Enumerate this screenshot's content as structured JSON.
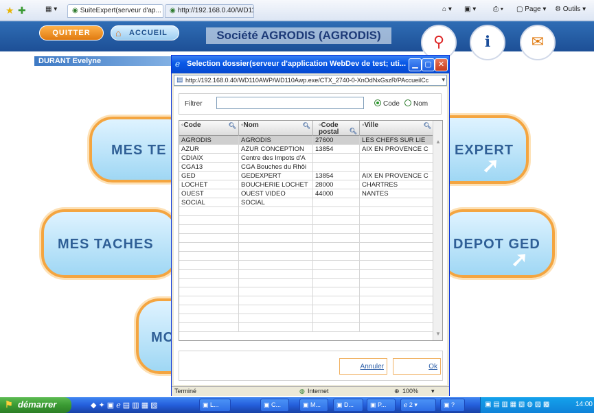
{
  "browser": {
    "tabs": [
      {
        "label": "SuiteExpert(serveur d'ap...",
        "close": "×"
      },
      {
        "label": "http://192.168.0.40/WD110..."
      }
    ],
    "commands": {
      "page": "Page",
      "tools": "Outils"
    }
  },
  "app": {
    "quit_label": "QUITTER",
    "home_label": "ACCUEIL",
    "title": "Société AGRODIS (AGRODIS)",
    "user_name": "DURANT Evelyne"
  },
  "tiles": {
    "mes_tes": "MES TE",
    "expert": "EXPERT",
    "mes_taches": "MES TACHES",
    "depot_ged": "DEPOT GED",
    "mo": "MO"
  },
  "dialog": {
    "title": "Selection dossier(serveur d'application WebDev de test; uti...",
    "address": "http://192.168.0.40/WD110AWP/WD110Awp.exe/CTX_2740-0-XnOdNxGszR/PAccueilCc",
    "filter_label": "Filtrer",
    "filter_value": "",
    "radio_code": "Code",
    "radio_nom": "Nom",
    "radio_selected": "Code",
    "columns": [
      "Code",
      "Nom",
      "Code postal",
      "Ville"
    ],
    "rows": [
      {
        "code": "AGRODIS",
        "nom": "AGRODIS",
        "cp": "27600",
        "ville": "LES CHEFS SUR LIE"
      },
      {
        "code": "AZUR",
        "nom": "AZUR CONCEPTION",
        "cp": "13854",
        "ville": "AIX EN PROVENCE C"
      },
      {
        "code": "CDIAIX",
        "nom": "Centre des Impots d'A",
        "cp": "",
        "ville": ""
      },
      {
        "code": "CGA13",
        "nom": "CGA Bouches du Rhôi",
        "cp": "",
        "ville": ""
      },
      {
        "code": "GED",
        "nom": "GEDEXPERT",
        "cp": "13854",
        "ville": "AIX EN PROVENCE C"
      },
      {
        "code": "LOCHET",
        "nom": "BOUCHERIE LOCHET",
        "cp": "28000",
        "ville": "CHARTRES"
      },
      {
        "code": "OUEST",
        "nom": "OUEST VIDEO",
        "cp": "44000",
        "ville": "NANTES"
      },
      {
        "code": "SOCIAL",
        "nom": "SOCIAL",
        "cp": "",
        "ville": ""
      }
    ],
    "cancel_label": "Annuler",
    "ok_label": "Ok",
    "status_text": "Terminé",
    "zone": "Internet",
    "zoom": "100%"
  },
  "taskbar": {
    "start_label": "démarrer",
    "tasks": [
      "L...",
      "C...",
      "M...",
      "D...",
      "P..."
    ],
    "group_count": "2",
    "clock": "14:00"
  }
}
